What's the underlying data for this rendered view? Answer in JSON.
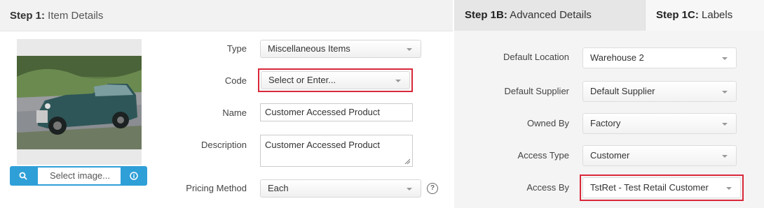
{
  "step1": {
    "title_bold": "Step 1:",
    "title_rest": " Item Details",
    "image_bar": {
      "placeholder": "Select image..."
    },
    "fields": {
      "type": {
        "label": "Type",
        "value": "Miscellaneous Items"
      },
      "code": {
        "label": "Code",
        "value": "Select or Enter..."
      },
      "name": {
        "label": "Name",
        "value": "Customer Accessed Product"
      },
      "description": {
        "label": "Description",
        "value": "Customer Accessed Product"
      },
      "pricing_method": {
        "label": "Pricing Method",
        "value": "Each",
        "help": "?"
      }
    }
  },
  "tabs": {
    "advanced": {
      "bold": "Step 1B:",
      "rest": " Advanced Details"
    },
    "labels": {
      "bold": "Step 1C:",
      "rest": " Labels"
    }
  },
  "advanced": {
    "default_location": {
      "label": "Default Location",
      "value": "Warehouse 2"
    },
    "default_supplier": {
      "label": "Default Supplier",
      "value": "Default Supplier"
    },
    "owned_by": {
      "label": "Owned By",
      "value": "Factory"
    },
    "access_type": {
      "label": "Access Type",
      "value": "Customer"
    },
    "access_by": {
      "label": "Access By",
      "value": "TstRet - Test Retail Customer"
    }
  },
  "colors": {
    "accent": "#2f9fd8",
    "highlight": "#d9283a"
  },
  "icons": {
    "search": "search-icon",
    "info": "info-icon",
    "help": "help-icon"
  }
}
